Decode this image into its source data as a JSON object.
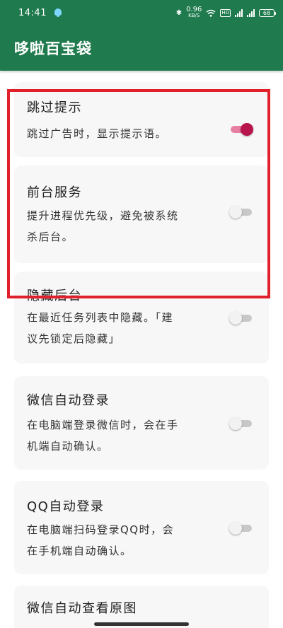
{
  "status_bar": {
    "time": "14:41",
    "speed_value": "0.96",
    "speed_unit": "KB/S",
    "hd_label": "HD",
    "battery": "68"
  },
  "app_bar": {
    "title": "哆啦百宝袋"
  },
  "settings": [
    {
      "title": "跳过提示",
      "desc_lines": [
        "跳过广告时，显示提示语。"
      ],
      "enabled": true
    },
    {
      "title": "前台服务",
      "desc_lines": [
        "提升进程优先级，避免被系统",
        "杀后台。"
      ],
      "enabled": false
    },
    {
      "title": "隐藏后台",
      "desc_lines": [
        "在最近任务列表中隐藏。「建",
        "议先锁定后隐藏」"
      ],
      "enabled": false
    },
    {
      "title": "微信自动登录",
      "desc_lines": [
        "在电脑端登录微信时，会在手",
        "机端自动确认。"
      ],
      "enabled": false
    },
    {
      "title": "QQ自动登录",
      "desc_lines": [
        "在电脑端扫码登录QQ时，会",
        "在手机端自动确认。"
      ],
      "enabled": false
    },
    {
      "title": "微信自动查看原图"
    }
  ],
  "colors": {
    "primary": "#1f7a4d",
    "accent": "#b8144d",
    "highlight_border": "#e0202a"
  }
}
